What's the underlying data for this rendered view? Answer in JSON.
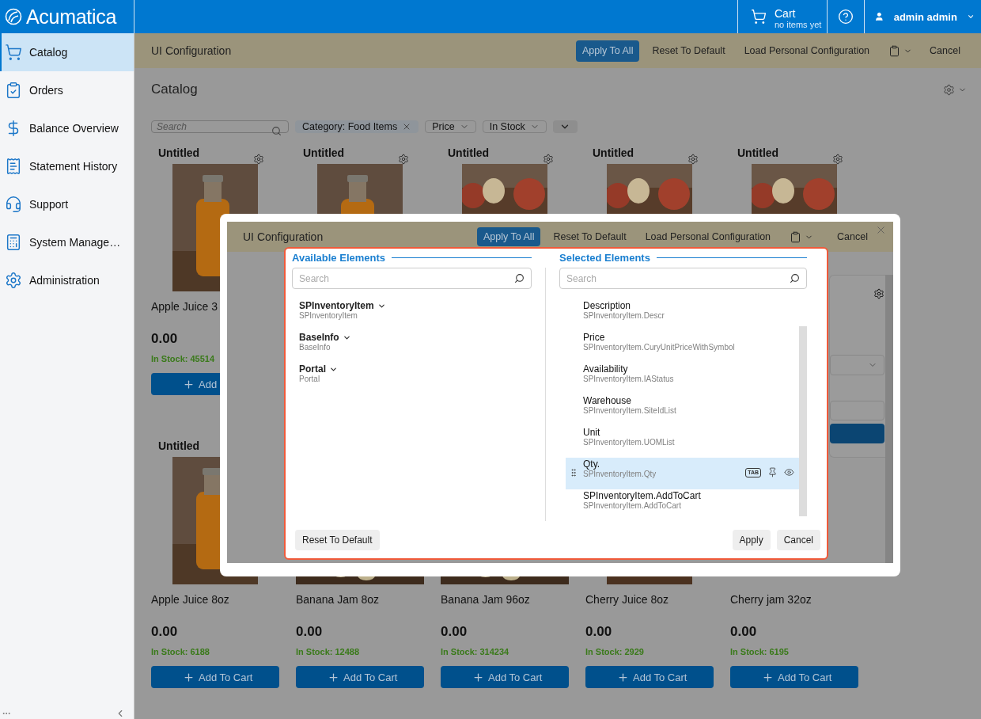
{
  "brand": {
    "name": "Acumatica"
  },
  "header": {
    "cart_label": "Cart",
    "cart_status": "no items yet",
    "user": "admin admin"
  },
  "sidebar": {
    "items": [
      {
        "label": "Catalog",
        "selected": true
      },
      {
        "label": "Orders",
        "selected": false
      },
      {
        "label": "Balance Overview",
        "selected": false
      },
      {
        "label": "Statement History",
        "selected": false
      },
      {
        "label": "Support",
        "selected": false
      },
      {
        "label": "System Manage…",
        "selected": false
      },
      {
        "label": "Administration",
        "selected": false
      }
    ]
  },
  "toolbar": {
    "title": "UI Configuration",
    "buttons": [
      {
        "label": "Apply To All",
        "kind": "primary"
      },
      {
        "label": "Reset To Default",
        "kind": "plain"
      },
      {
        "label": "Load Personal Configuration",
        "kind": "plain"
      },
      {
        "kind": "clipboard"
      },
      {
        "label": "Cancel",
        "kind": "plain"
      }
    ]
  },
  "page": {
    "title": "Catalog"
  },
  "filters": {
    "search": {
      "placeholder": "Search"
    },
    "chips": [
      {
        "label": "Category: Food Items",
        "kind": "removable"
      },
      {
        "label": "Price",
        "kind": "dropdown"
      },
      {
        "label": "In Stock",
        "kind": "dropdown"
      }
    ]
  },
  "rows": [
    {
      "cards": [
        {
          "title": "Untitled",
          "settings": true,
          "name": "Apple Juice 3",
          "price": "0.00",
          "stock": "In Stock: 45514",
          "button": "Add"
        },
        {
          "title": "Untitled",
          "settings": true
        },
        {
          "title": "Untitled",
          "settings": true
        },
        {
          "title": "Untitled",
          "settings": true
        },
        {
          "title": "Untitled",
          "settings": true
        }
      ]
    },
    {
      "cards": [
        {
          "title": "Untitled",
          "name": "Apple Juice 8oz",
          "price": "0.00",
          "stock": "In Stock: 6188",
          "button": "Add To Cart"
        },
        {
          "name": "Banana Jam 8oz",
          "price": "0.00",
          "stock": "In Stock: 12488",
          "button": "Add To Cart"
        },
        {
          "name": "Banana Jam 96oz",
          "price": "0.00",
          "stock": "In Stock: 314234",
          "button": "Add To Cart"
        },
        {
          "name": "Cherry Juice 8oz",
          "price": "0.00",
          "stock": "In Stock: 2929",
          "button": "Add To Cart"
        },
        {
          "name": "Cherry jam 32oz",
          "price": "0.00",
          "stock": "In Stock: 6195",
          "button": "Add To Cart"
        }
      ]
    }
  ],
  "dialog": {
    "toolbar": {
      "title": "UI Configuration",
      "buttons": [
        {
          "label": "Apply To All",
          "kind": "primary"
        },
        {
          "label": "Reset To Default",
          "kind": "plain"
        },
        {
          "label": "Load Personal Configuration",
          "kind": "plain"
        },
        {
          "kind": "clipboard"
        },
        {
          "label": "Cancel",
          "kind": "plain"
        }
      ]
    },
    "picker": {
      "available": {
        "title": "Available Elements",
        "search": {
          "placeholder": "Search"
        },
        "items": [
          {
            "label": "SPInventoryItem",
            "field": "SPInventoryItem"
          },
          {
            "label": "BaseInfo",
            "field": "BaseInfo"
          },
          {
            "label": "Portal",
            "field": "Portal"
          }
        ]
      },
      "selected": {
        "title": "Selected Elements",
        "search": {
          "placeholder": "Search"
        },
        "items": [
          {
            "label": "Description",
            "field": "SPInventoryItem.Descr",
            "selected": false
          },
          {
            "label": "Price",
            "field": "SPInventoryItem.CuryUnitPriceWithSymbol",
            "selected": false
          },
          {
            "label": "Availability",
            "field": "SPInventoryItem.IAStatus",
            "selected": false
          },
          {
            "label": "Warehouse",
            "field": "SPInventoryItem.SiteIdList",
            "selected": false
          },
          {
            "label": "Unit",
            "field": "SPInventoryItem.UOMList",
            "selected": false
          },
          {
            "label": "Qty.",
            "field": "SPInventoryItem.Qty",
            "selected": true,
            "badge": "TAB"
          },
          {
            "label": "SPInventoryItem.AddToCart",
            "field": "SPInventoryItem.AddToCart",
            "selected": false
          }
        ]
      },
      "footer": {
        "reset": "Reset To Default",
        "apply": "Apply",
        "cancel": "Cancel"
      }
    }
  }
}
